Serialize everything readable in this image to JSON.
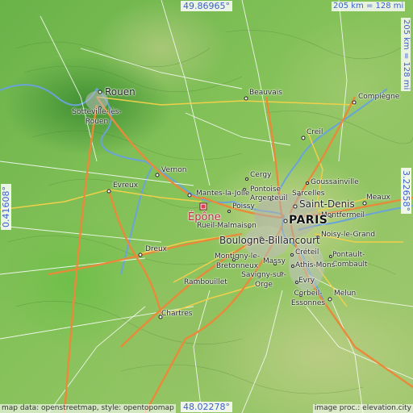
{
  "coordinates": {
    "top": "49.86965°",
    "bottom": "48.02278°",
    "left": "0.41608°",
    "right": "3.22658°"
  },
  "scales": {
    "horizontal": "205 km = 128 mi",
    "vertical": "205 km = 128 mi"
  },
  "credits": {
    "left": "map data: openstreetmap, style: opentopomap",
    "right": "image proc.: elevation.city"
  },
  "focus": {
    "name": "Épône",
    "color": "#c0223b"
  },
  "cities": [
    {
      "name": "Rouen",
      "size": "big"
    },
    {
      "name": "Sotteville-lès-Rouen",
      "size": "normal"
    },
    {
      "name": "Beauvais",
      "size": "normal"
    },
    {
      "name": "Compiègne",
      "size": "normal"
    },
    {
      "name": "Creil",
      "size": "normal"
    },
    {
      "name": "Vernon",
      "size": "normal"
    },
    {
      "name": "Evreux",
      "size": "normal"
    },
    {
      "name": "Cergy",
      "size": "normal"
    },
    {
      "name": "Pontoise",
      "size": "normal"
    },
    {
      "name": "Goussainville",
      "size": "normal"
    },
    {
      "name": "Sarcelles",
      "size": "normal"
    },
    {
      "name": "Mantes-la-Jolie",
      "size": "normal"
    },
    {
      "name": "Argenteuil",
      "size": "normal"
    },
    {
      "name": "Saint-Denis",
      "size": "big"
    },
    {
      "name": "Meaux",
      "size": "normal"
    },
    {
      "name": "Poissy",
      "size": "normal"
    },
    {
      "name": "Montfermeil",
      "size": "normal"
    },
    {
      "name": "PARIS",
      "size": "paris"
    },
    {
      "name": "Rueil-Malmaison",
      "size": "normal"
    },
    {
      "name": "Noisy-le-Grand",
      "size": "normal"
    },
    {
      "name": "Boulogne-Billancourt",
      "size": "big"
    },
    {
      "name": "Dreux",
      "size": "normal"
    },
    {
      "name": "Montigny-le-Bretonneux",
      "size": "normal"
    },
    {
      "name": "Créteil",
      "size": "normal"
    },
    {
      "name": "Pontault-Combault",
      "size": "normal"
    },
    {
      "name": "Massy",
      "size": "normal"
    },
    {
      "name": "Athis-Mons",
      "size": "normal"
    },
    {
      "name": "Savigny-sur-Orge",
      "size": "normal"
    },
    {
      "name": "Evry",
      "size": "normal"
    },
    {
      "name": "Rambouillet",
      "size": "normal"
    },
    {
      "name": "Corbeil-Essonnes",
      "size": "normal"
    },
    {
      "name": "Melun",
      "size": "normal"
    },
    {
      "name": "Chartres",
      "size": "normal"
    }
  ],
  "colors": {
    "coordinate_text": "#3c5fd0",
    "motorway": "#e88a3a",
    "primary_road": "#f0d04a",
    "river": "#6aa3d8"
  }
}
